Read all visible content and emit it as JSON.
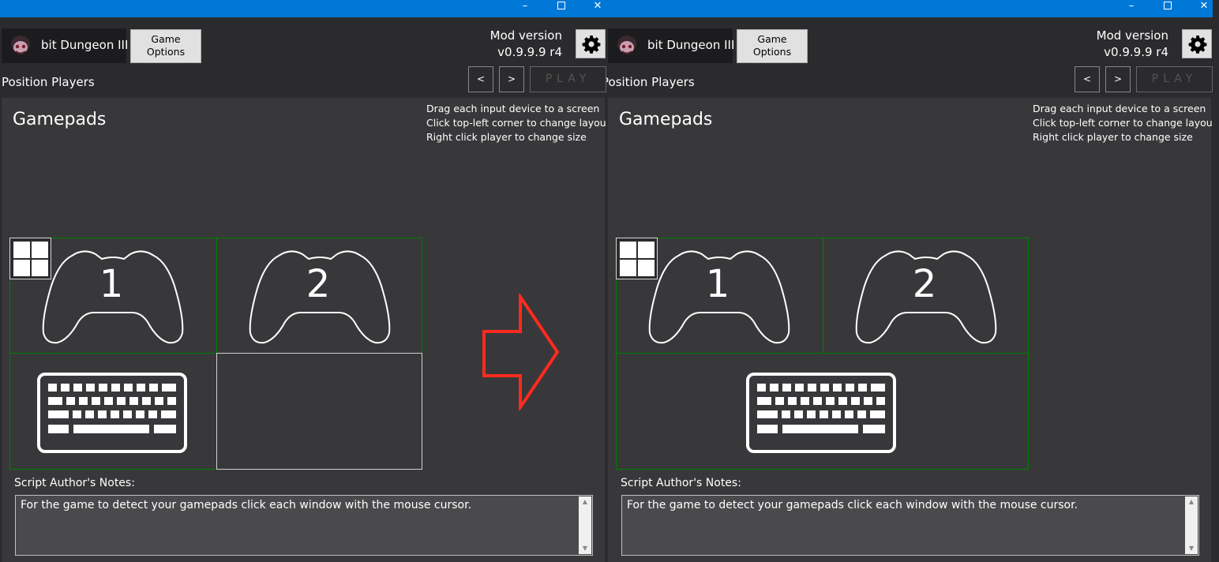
{
  "window_controls": {
    "minimize": "–",
    "close": "✕"
  },
  "header": {
    "game_title": "bit Dungeon III",
    "options_button_line1": "Game",
    "options_button_line2": "Options",
    "mod_version_label": "Mod version",
    "mod_version_value": "v0.9.9.9 r4",
    "settings_icon": "gear-icon"
  },
  "step": {
    "title": "Position Players",
    "prev_label": "<",
    "next_label": ">",
    "play_label": "PLAY"
  },
  "panel": {
    "section_title": "Gamepads",
    "hints": [
      "Drag each input device to a screen",
      "Click top-left corner to change layout",
      "Right click player to change size"
    ],
    "devices": [
      {
        "type": "gamepad",
        "number": "1",
        "icon": "gamepad-icon"
      },
      {
        "type": "gamepad",
        "number": "2",
        "icon": "gamepad-icon"
      },
      {
        "type": "keyboard",
        "icon": "keyboard-icon"
      }
    ]
  },
  "notes": {
    "label": "Script Author's Notes:",
    "text": "For the game to detect your gamepads click each window with the mouse cursor.",
    "scroll_up": "▲",
    "scroll_down": "▼"
  },
  "colors": {
    "titlebar": "#0078d7",
    "cell_border": "#008000",
    "arrow": "#ff2a1f",
    "background": "#2b2b2e",
    "panel": "#38383a"
  }
}
